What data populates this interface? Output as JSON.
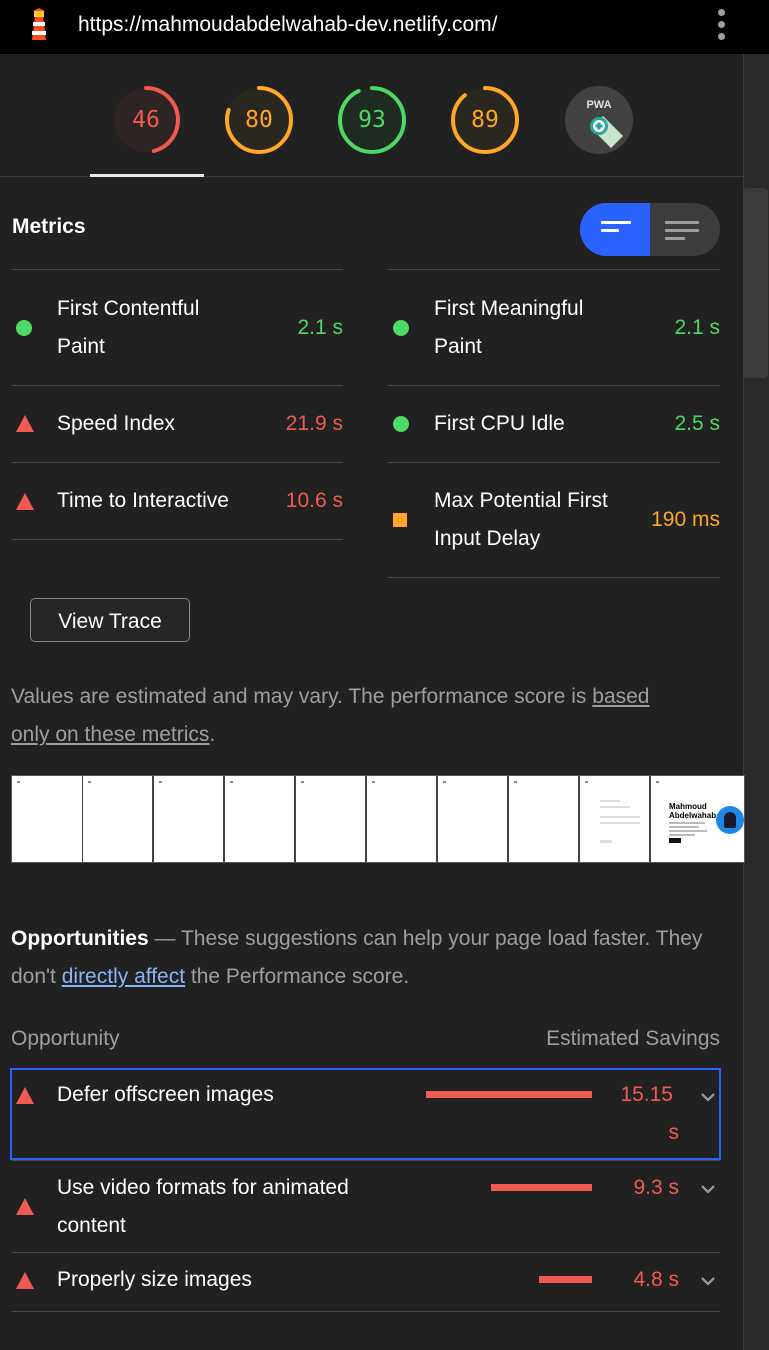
{
  "browser": {
    "url": "https://mahmoudabdelwahab-dev.netlify.com/",
    "lighthouse_icon": "lighthouse-icon",
    "menu_icon": "kebab-menu-icon"
  },
  "scores": [
    {
      "value": "46",
      "color": "#ef5b50",
      "fraction": 0.46
    },
    {
      "value": "80",
      "color": "#ffa726",
      "fraction": 0.8
    },
    {
      "value": "93",
      "color": "#4cd964",
      "fraction": 0.93
    },
    {
      "value": "89",
      "color": "#ffa726",
      "fraction": 0.89
    }
  ],
  "pwa_badge": {
    "label": "PWA",
    "icon": "pwa-badge-icon"
  },
  "metrics": {
    "title": "Metrics",
    "view_toggle": {
      "active": "expanded",
      "icons": [
        "compact-list-icon",
        "detailed-list-icon"
      ]
    },
    "items": [
      {
        "label_line1": "First Contentful",
        "label_line2": "Paint",
        "value": "2.1 s",
        "status": "pass"
      },
      {
        "label_line1": "First Meaningful",
        "label_line2": "Paint",
        "value": "2.1 s",
        "status": "pass"
      },
      {
        "label_line1": "Speed Index",
        "value": "21.9 s",
        "status": "fail"
      },
      {
        "label_line1": "First CPU Idle",
        "value": "2.5 s",
        "status": "pass"
      },
      {
        "label_line1": "Time to Interactive",
        "value": "10.6 s",
        "status": "fail"
      },
      {
        "label_line1": "Max Potential First",
        "label_line2": "Input Delay",
        "value": "190 ms",
        "status": "average"
      }
    ],
    "view_trace_label": "View Trace",
    "note_text": "Values are estimated and may vary. The performance score is ",
    "note_link_1": "based",
    "note_link_2": "only on these metrics",
    "note_end": "."
  },
  "filmstrip": {
    "frames": 10,
    "last_frame_title_1": "Mahmoud",
    "last_frame_title_2": "Abdelwahab."
  },
  "opportunities": {
    "title": "Opportunities",
    "dash": " — ",
    "text_1": "These suggestions can help your page load faster. They don't ",
    "link": "directly affect",
    "text_2": " the Performance score.",
    "col_opportunity": "Opportunity",
    "col_savings": "Estimated Savings",
    "rows": [
      {
        "title": "Defer offscreen images",
        "savings_line1": "15.15",
        "savings_line2": "s",
        "fraction": 1.0
      },
      {
        "title_line1": "Use video formats for animated",
        "title_line2": "content",
        "savings": "9.3 s",
        "fraction": 0.61
      },
      {
        "title": "Properly size images",
        "savings": "4.8 s",
        "fraction": 0.32
      }
    ]
  }
}
